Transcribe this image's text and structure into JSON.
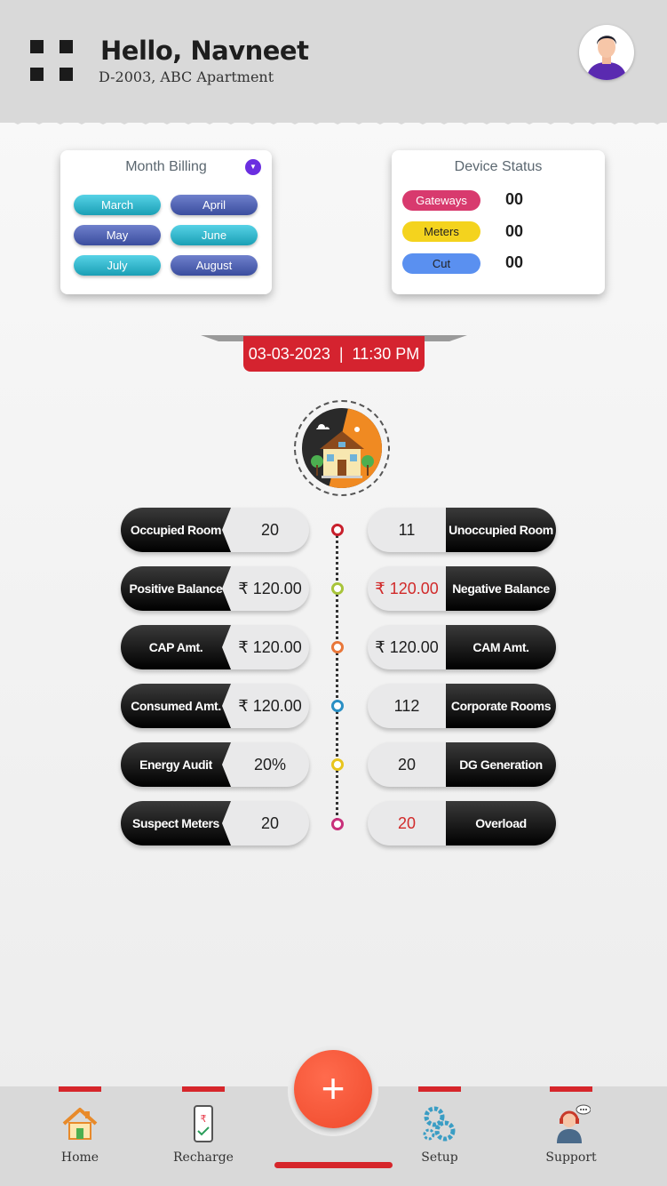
{
  "header": {
    "greeting": "Hello, Navneet",
    "address": "D-2003, ABC Apartment"
  },
  "month_billing": {
    "title": "Month Billing",
    "months": [
      "March",
      "April",
      "May",
      "June",
      "July",
      "August"
    ]
  },
  "device_status": {
    "title": "Device Status",
    "items": [
      {
        "label": "Gateways",
        "value": "00",
        "color": "#d83a6e"
      },
      {
        "label": "Meters",
        "value": "00",
        "color": "#f4d31e"
      },
      {
        "label": "Cut",
        "value": "00",
        "color": "#5a90f0"
      }
    ]
  },
  "datetime": "03-03-2023  |  11:30 PM",
  "stats_left": [
    {
      "label": "Occupied Room",
      "value": "20"
    },
    {
      "label": "Positive Balance",
      "value": "₹ 120.00"
    },
    {
      "label": "CAP Amt.",
      "value": "₹ 120.00"
    },
    {
      "label": "Consumed Amt.",
      "value": "₹ 120.00"
    },
    {
      "label": "Energy Audit",
      "value": "20%"
    },
    {
      "label": "Suspect Meters",
      "value": "20"
    }
  ],
  "stats_right": [
    {
      "label": "Unoccupied Room",
      "value": "11"
    },
    {
      "label": "Negative Balance",
      "value": "₹ 120.00"
    },
    {
      "label": "CAM Amt.",
      "value": "₹ 120.00"
    },
    {
      "label": "Corporate Rooms",
      "value": "112"
    },
    {
      "label": "DG Generation",
      "value": "20"
    },
    {
      "label": "Overload",
      "value": "20"
    }
  ],
  "timeline_colors": [
    "#c8202c",
    "#a8c43a",
    "#e8773a",
    "#2a8fc4",
    "#e8c51e",
    "#c8307a"
  ],
  "nav": {
    "home": "Home",
    "recharge": "Recharge",
    "fab": "+",
    "setup": "Setup",
    "support": "Support"
  },
  "colors": {
    "accent_red": "#d6262b",
    "fab": "#ef4a2c",
    "alert_value": "#d12a2a"
  }
}
